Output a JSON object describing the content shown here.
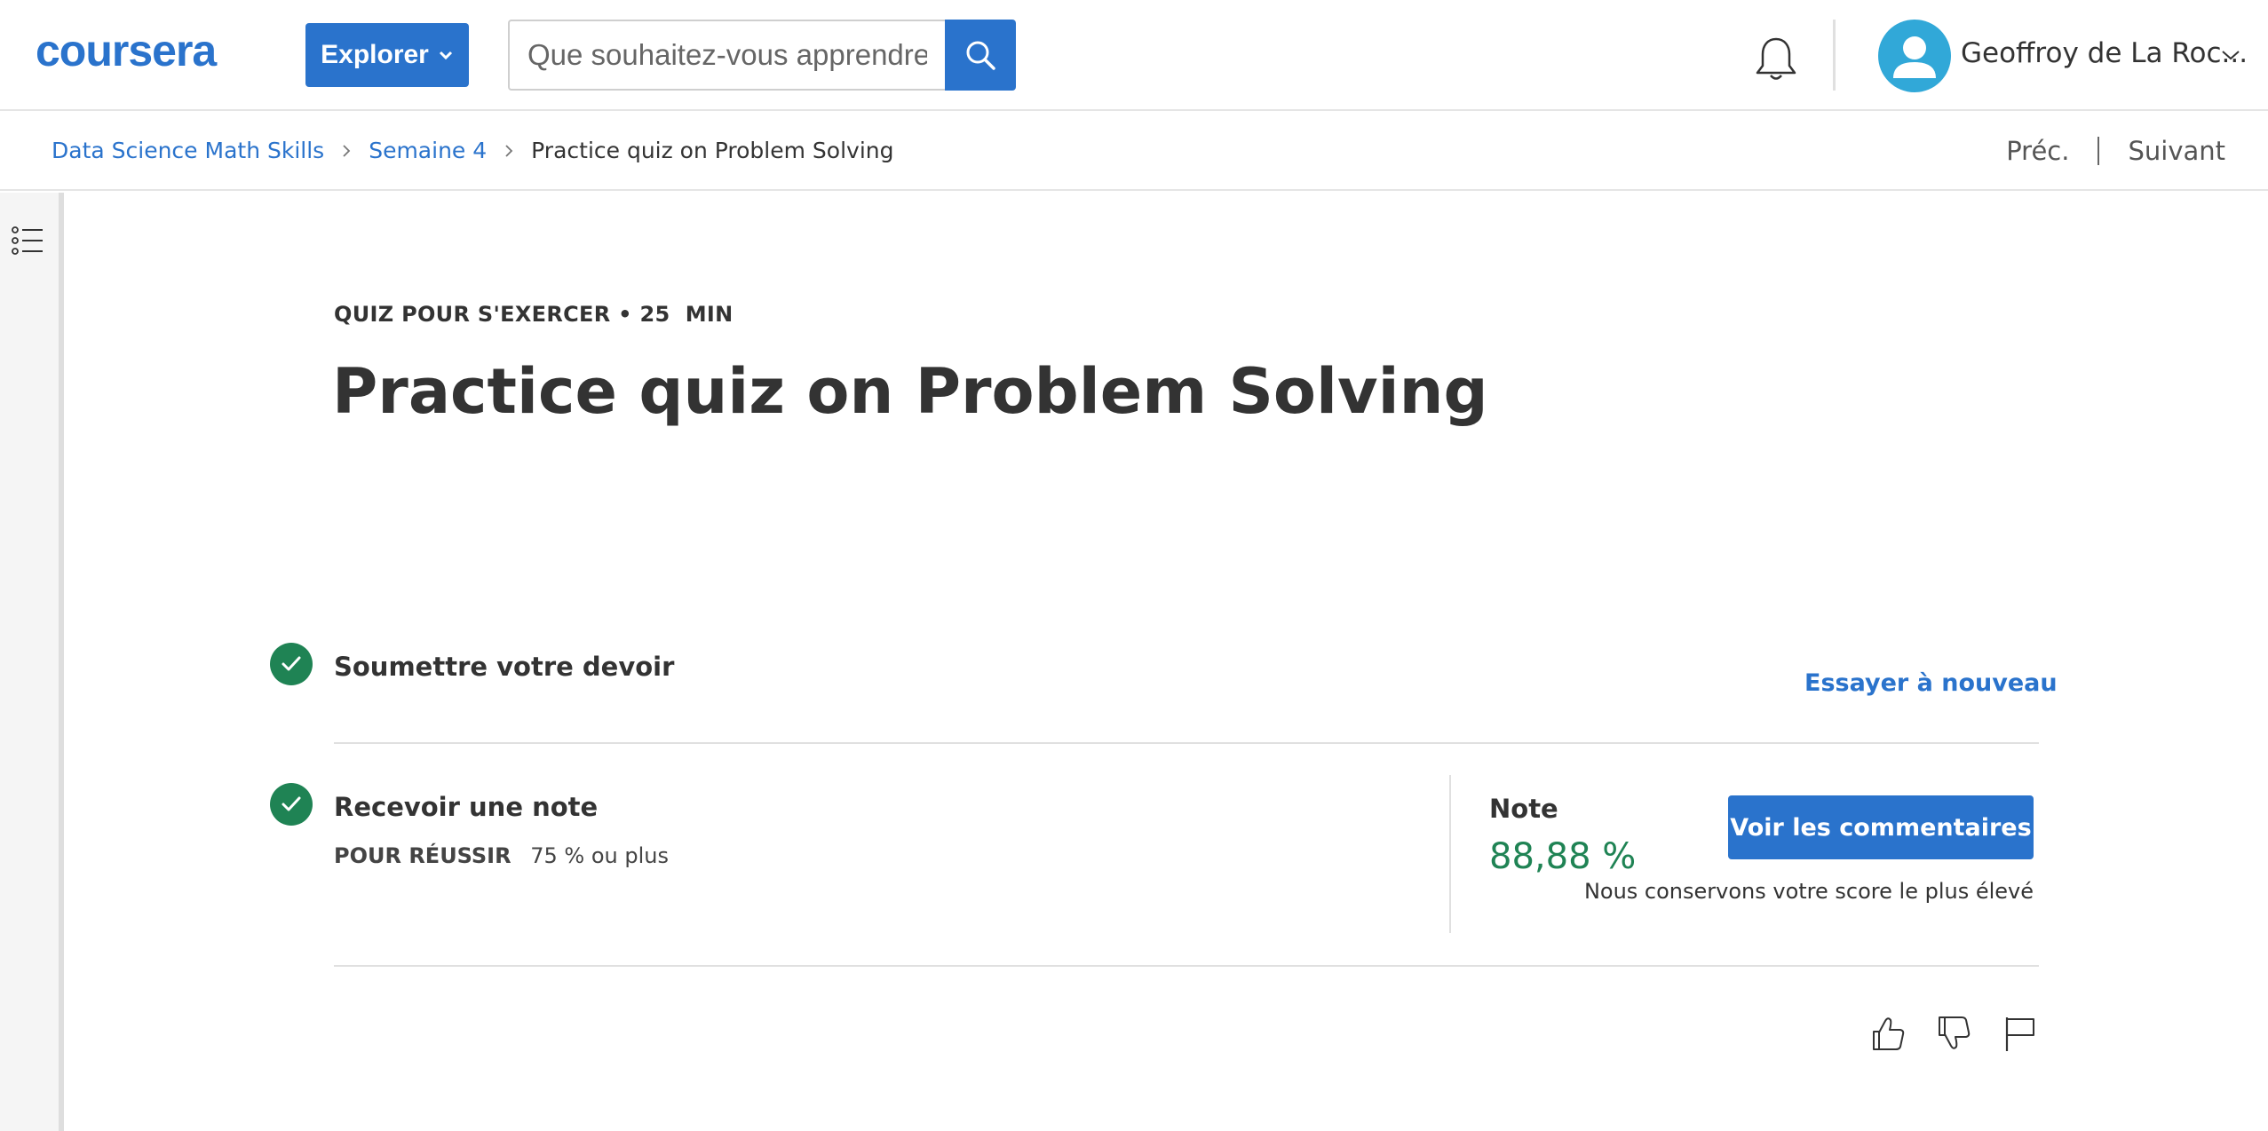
{
  "header": {
    "logo_text": "coursera",
    "explore_label": "Explorer",
    "search_placeholder": "Que souhaitez-vous apprendre ?",
    "user_name": "Geoffroy de La Roc..."
  },
  "breadcrumb": {
    "items": [
      "Data Science Math Skills",
      "Semaine 4"
    ],
    "current": "Practice quiz on Problem Solving",
    "prev_label": "Préc.",
    "next_label": "Suivant"
  },
  "main": {
    "eyebrow": "QUIZ POUR S'EXERCER • 25  MIN",
    "title": "Practice quiz on Problem Solving",
    "step1": {
      "title": "Soumettre votre devoir",
      "action_label": "Essayer à nouveau"
    },
    "step2": {
      "title": "Recevoir une note",
      "pass_label": "POUR RÉUSSIR",
      "pass_value": "75 % ou plus",
      "grade_label": "Note",
      "grade_value": "88,88 %",
      "feedback_button": "Voir les commentaires",
      "grade_note": "Nous conservons votre score le plus élevé"
    }
  },
  "colors": {
    "brand": "#2a73cc",
    "success": "#1f8354",
    "avatar": "#31a8d8"
  },
  "icons": [
    "search-icon",
    "bell-icon",
    "user-avatar-icon",
    "chevron-down-icon",
    "chevron-right-icon",
    "list-icon",
    "check-icon",
    "thumbs-up-icon",
    "thumbs-down-icon",
    "flag-icon"
  ]
}
